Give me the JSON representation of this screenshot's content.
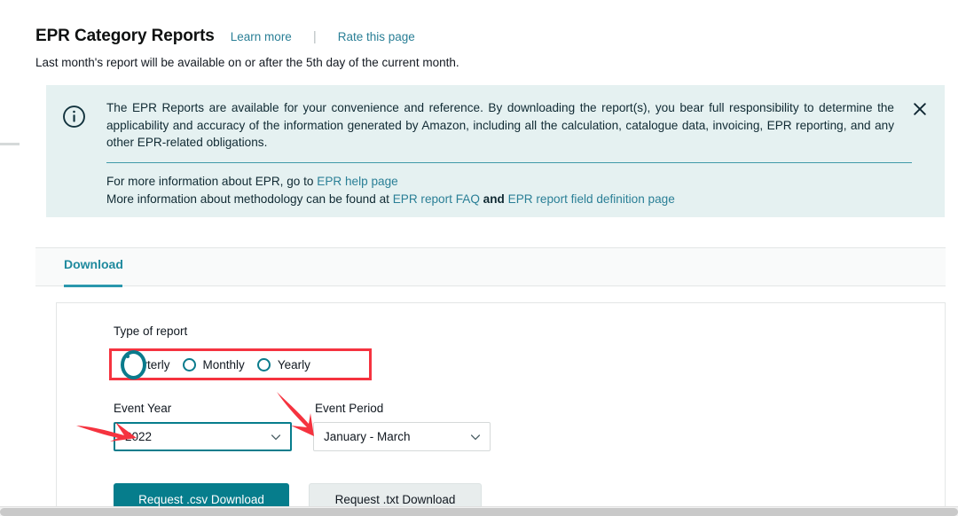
{
  "header": {
    "title": "EPR Category Reports",
    "learn_more": "Learn more",
    "separator": "|",
    "rate_page": "Rate this page",
    "subtitle": "Last month's report will be available on or after the 5th day of the current month."
  },
  "banner": {
    "icon": "info-circle-icon",
    "close_icon": "close-icon",
    "background_color": "#e5f1f1",
    "paragraph": "The EPR Reports are available for your convenience and reference. By downloading the report(s), you bear full responsibility to determine the applicability and accuracy of the information generated by Amazon, including all the calculation, catalogue data, invoicing, EPR reporting, and any other EPR-related obligations.",
    "line1_prefix": "For more information about EPR, go to ",
    "line1_link": "EPR help page",
    "line2_prefix": "More information about methodology can be found at ",
    "line2_link1": "EPR report FAQ",
    "line2_middle": " and ",
    "line2_link2": "EPR report field definition page"
  },
  "tabs": [
    {
      "label": "Download",
      "active": true
    }
  ],
  "form": {
    "type_of_report": {
      "label": "Type of report",
      "selected": "Quarterly",
      "options": [
        "Quarterly",
        "Monthly",
        "Yearly"
      ],
      "highlight_color": "#f5333f"
    },
    "event_year": {
      "label": "Event Year",
      "value": "2022",
      "chevron": "chevron-down-icon",
      "border_color": "#067d8c"
    },
    "event_period": {
      "label": "Event Period",
      "value": "January - March",
      "chevron": "chevron-down-icon"
    },
    "buttons": {
      "csv": "Request .csv Download",
      "txt": "Request .txt Download",
      "csv_color": "#067d8c"
    }
  },
  "annotations": {
    "arrow_color": "#f5333f",
    "arrow_year_target": "event-year-select",
    "arrow_period_target": "event-period-select"
  },
  "colors": {
    "link": "#2a7f96",
    "accent_teal": "#067d8c",
    "tab_active": "#1f8a9e",
    "text": "#0f1111"
  }
}
